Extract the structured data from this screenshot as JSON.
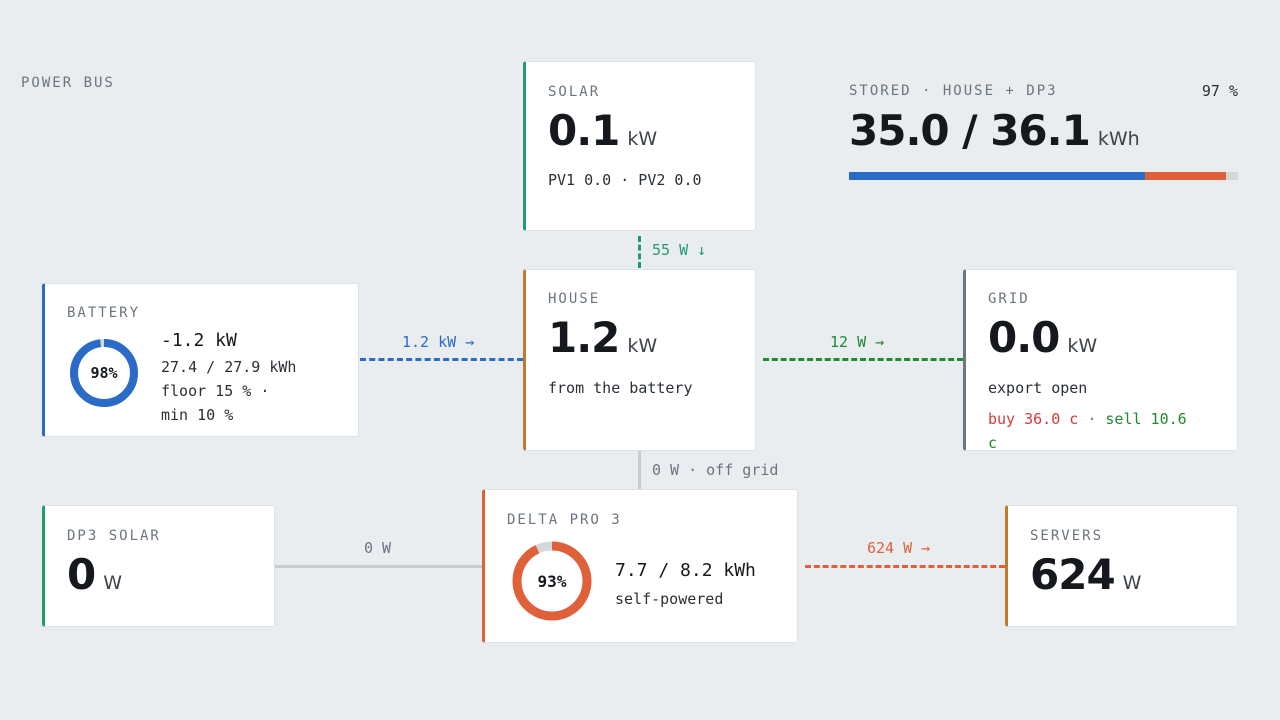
{
  "title": "POWER BUS",
  "colors": {
    "solar": "#1e9e6e",
    "battery": "#2a6bc8",
    "house": "#c07a2c",
    "grid": "#6e767e",
    "dp3": "#e0603a",
    "export_green": "#1f8a2e",
    "buy_red": "#d23b3b",
    "track": "#d4d8dc"
  },
  "solar": {
    "label": "SOLAR",
    "value": "0.1",
    "unit": "kW",
    "detail": "PV1 0.0 · PV2 0.0"
  },
  "stored": {
    "label": "STORED · HOUSE + DP3",
    "value": "35.0 / 36.1",
    "unit": "kWh",
    "percent_text": "97 %",
    "house_fraction": 0.76,
    "dp3_fraction": 0.21
  },
  "battery": {
    "label": "BATTERY",
    "percent": 98,
    "percent_text": "98%",
    "power": "-1.2 kW",
    "energy": "27.4 / 27.9 kWh",
    "floor": "floor 15 % ·",
    "min": "min 10 %"
  },
  "house": {
    "label": "HOUSE",
    "value": "1.2",
    "unit": "kW",
    "detail": "from the battery"
  },
  "grid": {
    "label": "GRID",
    "value": "0.0",
    "unit": "kW",
    "detail": "export open",
    "buy": "buy 36.0 c",
    "sep": " · ",
    "sell": "sell 10.6",
    "sell_unit": "c"
  },
  "dp3_solar": {
    "label": "DP3 SOLAR",
    "value": "0",
    "unit": "W"
  },
  "delta": {
    "label": "DELTA PRO 3",
    "percent": 93,
    "percent_text": "93%",
    "energy": "7.7 / 8.2 kWh",
    "detail": "self-powered"
  },
  "servers": {
    "label": "SERVERS",
    "value": "624",
    "unit": "W"
  },
  "flows": {
    "solar_house": "55 W ↓",
    "battery_house": "1.2 kW →",
    "house_grid": "12 W →",
    "house_delta": "0 W · off grid",
    "dp3solar_delta": "0 W",
    "delta_servers": "624 W →"
  }
}
